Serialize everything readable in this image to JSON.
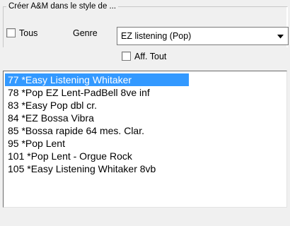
{
  "group": {
    "title": "Créer A&M dans le style de ..."
  },
  "filters": {
    "all_label": "Tous",
    "all_checked": false,
    "genre_label": "Genre",
    "genre_value": "EZ listening (Pop)",
    "show_all_label": "Aff. Tout",
    "show_all_checked": false
  },
  "styles_list": {
    "selected_index": 0,
    "items": [
      "77 *Easy Listening Whitaker",
      "78 *Pop EZ Lent-PadBell 8ve inf",
      "83 *Easy Pop dbl cr.",
      "84 *EZ Bossa Vibra",
      "85 *Bossa rapide 64 mes. Clar.",
      "95 *Pop Lent",
      "101 *Pop Lent - Orgue Rock",
      "105 *Easy Listening Whitaker 8vb"
    ]
  },
  "icons": {
    "combo_arrow": "chevron-down-icon"
  },
  "colors": {
    "selection": "#3399ff",
    "selection_text": "#ffffff"
  }
}
